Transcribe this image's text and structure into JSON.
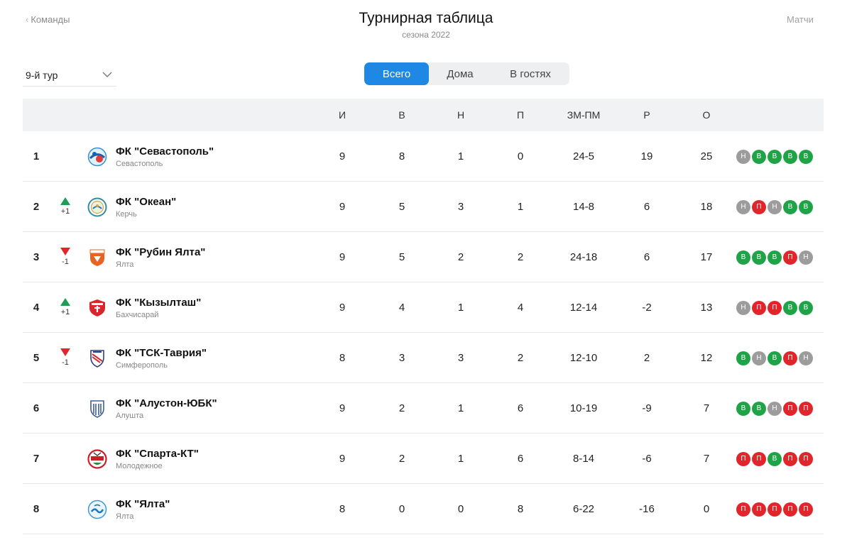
{
  "header": {
    "back_label": "Команды",
    "title": "Турнирная таблица",
    "subtitle": "сезона 2022",
    "matches_label": "Матчи"
  },
  "filters": {
    "round_value": "9-й тур",
    "tabs": [
      "Всего",
      "Дома",
      "В гостях"
    ],
    "active_tab": "Всего"
  },
  "table": {
    "columns": [
      "И",
      "В",
      "Н",
      "П",
      "ЗМ-ПМ",
      "Р",
      "О"
    ],
    "rows": [
      {
        "pos": "1",
        "trend": "",
        "trend_label": "",
        "name": "ФК \"Севастополь\"",
        "city": "Севастополь",
        "logo": "sevastopol-logo",
        "played": "9",
        "won": "8",
        "drawn": "1",
        "lost": "0",
        "goals": "24-5",
        "diff": "19",
        "points": "25",
        "form": [
          "Н",
          "В",
          "В",
          "В",
          "В"
        ]
      },
      {
        "pos": "2",
        "trend": "up",
        "trend_label": "+1",
        "name": "ФК \"Океан\"",
        "city": "Керчь",
        "logo": "okean-logo",
        "played": "9",
        "won": "5",
        "drawn": "3",
        "lost": "1",
        "goals": "14-8",
        "diff": "6",
        "points": "18",
        "form": [
          "Н",
          "П",
          "Н",
          "В",
          "В"
        ]
      },
      {
        "pos": "3",
        "trend": "down",
        "trend_label": "-1",
        "name": "ФК \"Рубин Ялта\"",
        "city": "Ялта",
        "logo": "rubin-logo",
        "played": "9",
        "won": "5",
        "drawn": "2",
        "lost": "2",
        "goals": "24-18",
        "diff": "6",
        "points": "17",
        "form": [
          "В",
          "В",
          "В",
          "П",
          "Н"
        ]
      },
      {
        "pos": "4",
        "trend": "up",
        "trend_label": "+1",
        "name": "ФК \"Кызылташ\"",
        "city": "Бахчисарай",
        "logo": "kyzyltash-logo",
        "played": "9",
        "won": "4",
        "drawn": "1",
        "lost": "4",
        "goals": "12-14",
        "diff": "-2",
        "points": "13",
        "form": [
          "Н",
          "П",
          "П",
          "В",
          "В"
        ]
      },
      {
        "pos": "5",
        "trend": "down",
        "trend_label": "-1",
        "name": "ФК \"ТСК-Таврия\"",
        "city": "Симферополь",
        "logo": "tavriya-logo",
        "played": "8",
        "won": "3",
        "drawn": "3",
        "lost": "2",
        "goals": "12-10",
        "diff": "2",
        "points": "12",
        "form": [
          "В",
          "Н",
          "В",
          "П",
          "Н"
        ]
      },
      {
        "pos": "6",
        "trend": "",
        "trend_label": "",
        "name": "ФК \"Алустон-ЮБК\"",
        "city": "Алушта",
        "logo": "aluston-logo",
        "played": "9",
        "won": "2",
        "drawn": "1",
        "lost": "6",
        "goals": "10-19",
        "diff": "-9",
        "points": "7",
        "form": [
          "В",
          "В",
          "Н",
          "П",
          "П"
        ]
      },
      {
        "pos": "7",
        "trend": "",
        "trend_label": "",
        "name": "ФК \"Спарта-КТ\"",
        "city": "Молодежное",
        "logo": "sparta-logo",
        "played": "9",
        "won": "2",
        "drawn": "1",
        "lost": "6",
        "goals": "8-14",
        "diff": "-6",
        "points": "7",
        "form": [
          "П",
          "П",
          "В",
          "П",
          "П"
        ]
      },
      {
        "pos": "8",
        "trend": "",
        "trend_label": "",
        "name": "ФК \"Ялта\"",
        "city": "Ялта",
        "logo": "yalta-logo",
        "played": "8",
        "won": "0",
        "drawn": "0",
        "lost": "8",
        "goals": "6-22",
        "diff": "-16",
        "points": "0",
        "form": [
          "П",
          "П",
          "П",
          "П",
          "П"
        ]
      }
    ]
  },
  "colors": {
    "accent": "#1f88e5",
    "win": "#1fa347",
    "loss": "#e0262b",
    "draw": "#9c9c9c",
    "trend_up": "#1f9d55",
    "trend_down": "#e0262b"
  }
}
